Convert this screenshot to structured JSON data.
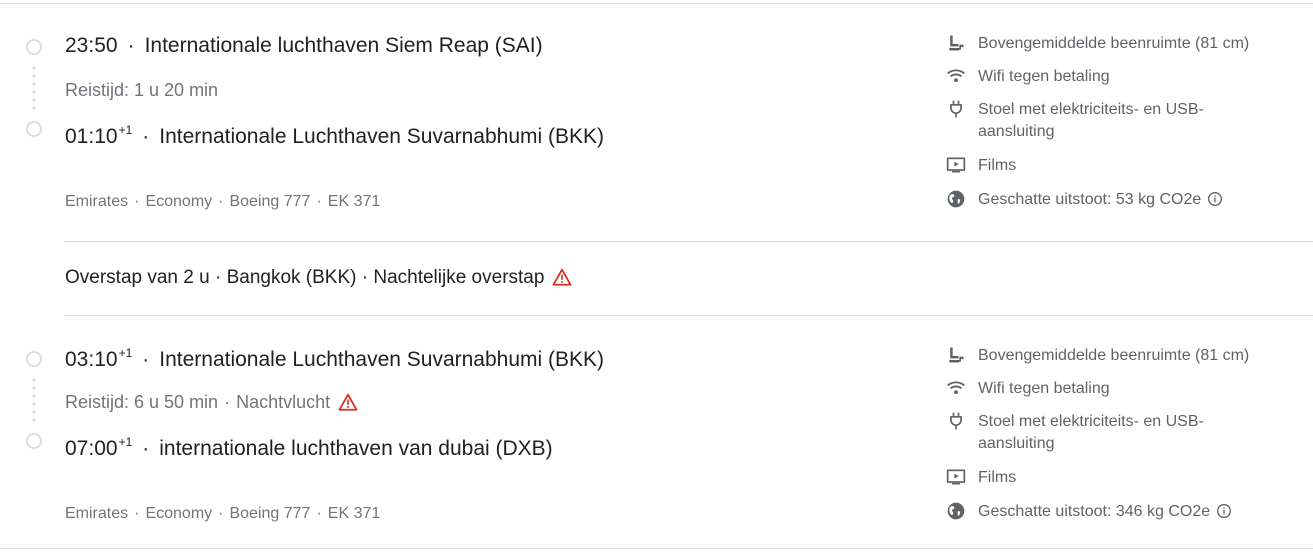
{
  "segments": [
    {
      "departure": {
        "time": "23:50",
        "time_sup": "",
        "airport": "Internationale luchthaven Siem Reap (SAI)"
      },
      "travel_time": "Reistijd: 1 u 20 min",
      "travel_note": "",
      "arrival": {
        "time": "01:10",
        "time_sup": "+1",
        "airport": "Internationale Luchthaven Suvarnabhumi (BKK)"
      },
      "meta": [
        "Emirates",
        "Economy",
        "Boeing 777",
        "EK 371"
      ],
      "amenities": [
        {
          "icon": "seat-legroom-icon",
          "text": "Bovengemiddelde beenruimte (81 cm)"
        },
        {
          "icon": "wifi-icon",
          "text": "Wifi tegen betaling"
        },
        {
          "icon": "power-plug-icon",
          "text": "Stoel met elektriciteits- en USB-aansluiting"
        },
        {
          "icon": "movie-screen-icon",
          "text": "Films"
        },
        {
          "icon": "globe-icon",
          "text": "Geschatte uitstoot: 53 kg CO2e"
        }
      ]
    },
    {
      "departure": {
        "time": "03:10",
        "time_sup": "+1",
        "airport": "Internationale Luchthaven Suvarnabhumi (BKK)"
      },
      "travel_time": "Reistijd: 6 u 50 min",
      "travel_note": "Nachtvlucht",
      "arrival": {
        "time": "07:00",
        "time_sup": "+1",
        "airport": "internationale luchthaven van dubai (DXB)"
      },
      "meta": [
        "Emirates",
        "Economy",
        "Boeing 777",
        "EK 371"
      ],
      "amenities": [
        {
          "icon": "seat-legroom-icon",
          "text": "Bovengemiddelde beenruimte (81 cm)"
        },
        {
          "icon": "wifi-icon",
          "text": "Wifi tegen betaling"
        },
        {
          "icon": "power-plug-icon",
          "text": "Stoel met elektriciteits- en USB-aansluiting"
        },
        {
          "icon": "movie-screen-icon",
          "text": "Films"
        },
        {
          "icon": "globe-icon",
          "text": "Geschatte uitstoot: 346 kg CO2e"
        }
      ]
    }
  ],
  "layover": {
    "text": "Overstap van 2 u · Bangkok (BKK) · Nachtelijke overstap"
  },
  "separators": {
    "dot": "·"
  },
  "colors": {
    "warning": "#d93025",
    "text_primary": "#202124",
    "text_secondary": "#70757a",
    "divider": "#dadce0"
  }
}
